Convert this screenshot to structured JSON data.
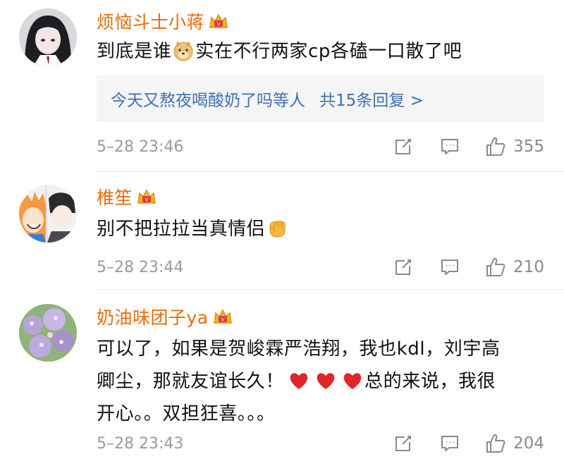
{
  "colors": {
    "username": "#e86b0a",
    "reply_link": "#3e6eb4",
    "meta": "#9a9a9a",
    "heart": "#e0252b"
  },
  "comments": [
    {
      "username": "烦恼斗士小蒋",
      "badge_icon": "crown-badge-icon",
      "text_before": "到底是谁",
      "inline_icon": "doge-emoji-icon",
      "text_after": "实在不行两家cp各磕一口散了吧",
      "reply_summary": {
        "users": "今天又熬夜喝酸奶了吗等人",
        "count": "共15条回复 >"
      },
      "timestamp": "5–28 23:46",
      "likes": "355"
    },
    {
      "username": "椎笙",
      "badge_icon": "crown-badge-icon",
      "text_before": "别不把拉拉当真情侣",
      "inline_icon": "fist-emoji-icon",
      "text_after": "",
      "timestamp": "5–28 23:44",
      "likes": "210"
    },
    {
      "username": "奶油味团子ya",
      "badge_icon": "crown-badge-icon",
      "line1": "可以了，如果是贺峻霖严浩翔，我也kdl，刘宇高",
      "line2_before": "卿尘，那就友谊长久！",
      "line2_icons": [
        "heart-emoji-icon",
        "heart-emoji-icon",
        "heart-emoji-icon"
      ],
      "line2_after": "总的来说，我很",
      "line3": "开心。。双担狂喜。。。",
      "timestamp": "5–28 23:43",
      "likes": "204"
    }
  ]
}
